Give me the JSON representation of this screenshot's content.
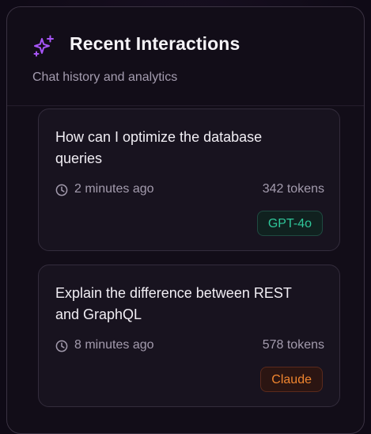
{
  "header": {
    "title": "Recent Interactions",
    "subtitle": "Chat history and analytics",
    "icon": "sparkles-icon",
    "accent_color": "#a855f7"
  },
  "interactions": [
    {
      "question": "How can I optimize the database queries",
      "time": "2 minutes ago",
      "tokens": "342 tokens",
      "model": "GPT-4o",
      "model_color": "#2fc79a"
    },
    {
      "question": "Explain the difference between REST and GraphQL",
      "time": "8 minutes ago",
      "tokens": "578 tokens",
      "model": "Claude",
      "model_color": "#f0852f"
    }
  ]
}
